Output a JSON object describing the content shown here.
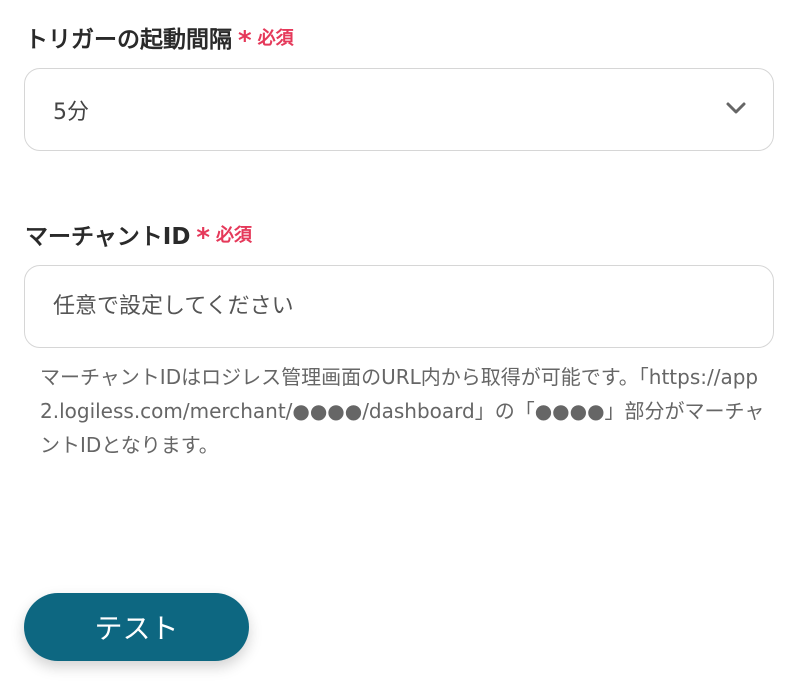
{
  "trigger_interval": {
    "label": "トリガーの起動間隔",
    "required_mark": "*",
    "required_text": "必須",
    "selected_value": "5分"
  },
  "merchant_id": {
    "label": "マーチャントID",
    "required_mark": "*",
    "required_text": "必須",
    "placeholder": "任意で設定してください",
    "help_text": "マーチャントIDはロジレス管理画面のURL内から取得が可能です。「https://app2.logiless.com/merchant/●●●●/dashboard」の「●●●●」部分がマーチャントIDとなります。"
  },
  "test_button": {
    "label": "テスト"
  },
  "colors": {
    "required": "#e5395a",
    "button_bg": "#0d6781",
    "border": "#d6d6d6"
  },
  "icons": {
    "select_indicator": "chevron-down-icon",
    "required_indicator": "asterisk-icon"
  }
}
